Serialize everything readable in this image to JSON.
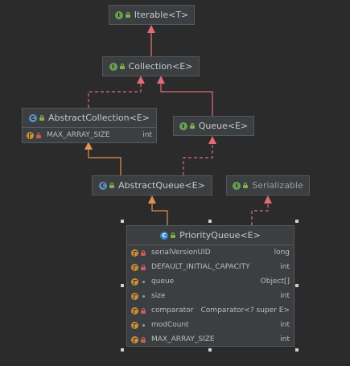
{
  "diagram": {
    "nodes": {
      "iterable": {
        "name": "Iterable<T>"
      },
      "collection": {
        "name": "Collection<E>"
      },
      "abstract_collection": {
        "name": "AbstractCollection<E>",
        "fields": [
          {
            "name": "MAX_ARRAY_SIZE",
            "type": "int"
          }
        ]
      },
      "queue": {
        "name": "Queue<E>"
      },
      "abstract_queue": {
        "name": "AbstractQueue<E>"
      },
      "serializable": {
        "name": "Serializable"
      },
      "priority_queue": {
        "name": "PriorityQueue<E>",
        "fields": [
          {
            "name": "serialVersionUID",
            "type": "long"
          },
          {
            "name": "DEFAULT_INITIAL_CAPACITY",
            "type": "int"
          },
          {
            "name": "queue",
            "type": "Object[]"
          },
          {
            "name": "size",
            "type": "int"
          },
          {
            "name": "comparator",
            "type": "Comparator<? super E>"
          },
          {
            "name": "modCount",
            "type": "int"
          },
          {
            "name": "MAX_ARRAY_SIZE",
            "type": "int"
          }
        ]
      }
    },
    "colors": {
      "background": "#2b2b2b",
      "node_fill": "#3c3f41",
      "extends_arrow": "#e7904c",
      "implements_arrow": "#e06c75",
      "text": "#bbbbbb"
    },
    "icons": {
      "interface": "interface-icon",
      "abstract_class": "abstract-class-icon",
      "class": "class-icon",
      "field": "field-icon",
      "lock": "lock-icon"
    }
  }
}
